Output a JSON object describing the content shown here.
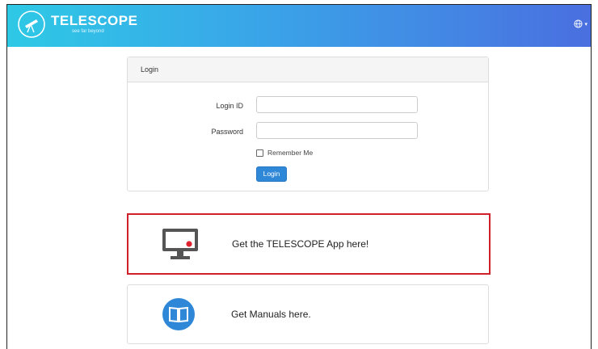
{
  "header": {
    "brand": "TELESCOPE",
    "tagline": "see far beyond",
    "language_caret": "▾"
  },
  "login": {
    "panel_title": "Login",
    "login_id_label": "Login ID",
    "login_id_value": "",
    "password_label": "Password",
    "password_value": "",
    "remember_label": "Remember Me",
    "remember_checked": false,
    "submit_label": "Login"
  },
  "cards": {
    "app_label": "Get the TELESCOPE App here!",
    "manuals_label": "Get Manuals here."
  },
  "colors": {
    "header_gradient_start": "#2ec9e6",
    "header_gradient_end": "#4a6fe0",
    "primary_button": "#2f87d8",
    "highlight_border": "#d0202a",
    "icon_dark": "#555555",
    "icon_red_dot": "#e0222e",
    "icon_blue": "#2f87d8"
  },
  "icons": {
    "logo": "telescope-logo-icon",
    "language": "globe-icon",
    "app": "monitor-icon",
    "manuals": "book-icon"
  }
}
